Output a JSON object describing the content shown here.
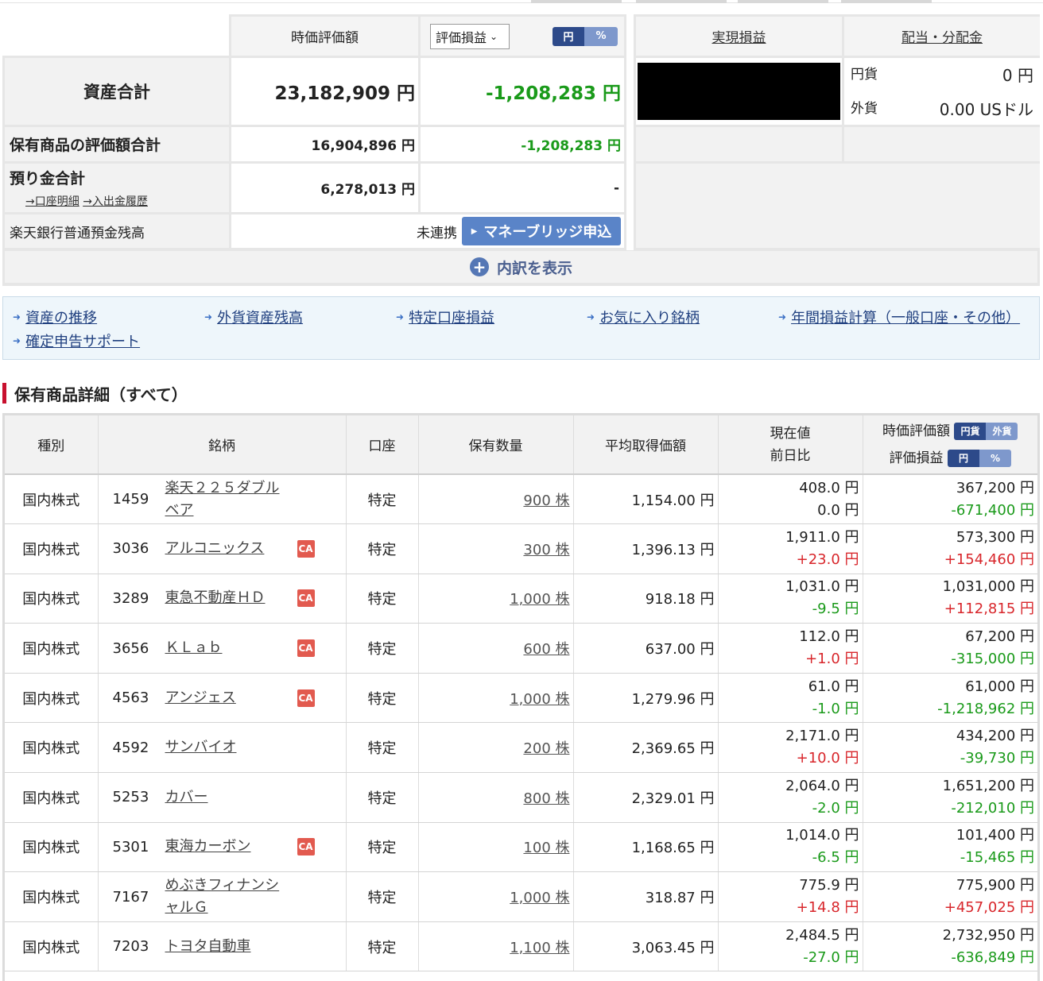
{
  "summary": {
    "col_market_value": "時価評価額",
    "col_pl_select": "評価損益",
    "unit_toggle": {
      "yen": "円",
      "pct": "%"
    },
    "realized_pl_link": "実現損益",
    "dividend_link": "配当・分配金",
    "total_assets_label": "資産合計",
    "total_assets_value": "23,182,909 円",
    "total_assets_pl": "-1,208,283 円",
    "holdings_label": "保有商品の評価額合計",
    "holdings_value": "16,904,896 円",
    "holdings_pl": "-1,208,283 円",
    "deposit_label": "預り金合計",
    "deposit_value": "6,278,013 円",
    "deposit_pl": "-",
    "account_detail_link": "→口座明細",
    "inout_history_link": "→入出金履歴",
    "bank_label": "楽天銀行普通預金残高",
    "bank_status": "未連携",
    "moneybridge_button": "マネーブリッジ申込",
    "show_breakdown": "内訳を表示",
    "dividend": {
      "jpy_label": "円貨",
      "jpy_value": "0 円",
      "fx_label": "外貨",
      "fx_value": "0.00 USドル"
    }
  },
  "quick_links": [
    "資産の推移",
    "外貨資産残高",
    "特定口座損益",
    "お気に入り銘柄",
    "年間損益計算（一般口座・その他）",
    "確定申告サポート"
  ],
  "holdings": {
    "title": "保有商品詳細（すべて）",
    "headers": {
      "type": "種別",
      "name": "銘柄",
      "account": "口座",
      "qty": "保有数量",
      "avg_cost": "平均取得価額",
      "price": "現在値",
      "change": "前日比",
      "market_value": "時価評価額",
      "pl": "評価損益",
      "ccy_toggle": {
        "a": "円貨",
        "b": "外貨"
      },
      "pl_toggle": {
        "a": "円",
        "b": "%"
      }
    },
    "rows": [
      {
        "type": "国内株式",
        "code": "1459",
        "name1": "楽天２２５ダブル",
        "name2": "ベア",
        "ca": "",
        "account": "特定",
        "qty": "900 株",
        "avg": "1,154.00 円",
        "price": "408.0 円",
        "change": "0.0 円",
        "change_dir": "flat",
        "value": "367,200 円",
        "pl": "-671,400 円",
        "pl_dir": "neg"
      },
      {
        "type": "国内株式",
        "code": "3036",
        "name1": "アルコニックス",
        "name2": "",
        "ca": "CA",
        "account": "特定",
        "qty": "300 株",
        "avg": "1,396.13 円",
        "price": "1,911.0 円",
        "change": "+23.0 円",
        "change_dir": "pos",
        "value": "573,300 円",
        "pl": "+154,460 円",
        "pl_dir": "pos"
      },
      {
        "type": "国内株式",
        "code": "3289",
        "name1": "東急不動産ＨＤ",
        "name2": "",
        "ca": "CA",
        "account": "特定",
        "qty": "1,000 株",
        "avg": "918.18 円",
        "price": "1,031.0 円",
        "change": "-9.5 円",
        "change_dir": "neg",
        "value": "1,031,000 円",
        "pl": "+112,815 円",
        "pl_dir": "pos"
      },
      {
        "type": "国内株式",
        "code": "3656",
        "name1": "ＫＬａｂ",
        "name2": "",
        "ca": "CA",
        "account": "特定",
        "qty": "600 株",
        "avg": "637.00 円",
        "price": "112.0 円",
        "change": "+1.0 円",
        "change_dir": "pos",
        "value": "67,200 円",
        "pl": "-315,000 円",
        "pl_dir": "neg"
      },
      {
        "type": "国内株式",
        "code": "4563",
        "name1": "アンジェス",
        "name2": "",
        "ca": "CA",
        "account": "特定",
        "qty": "1,000 株",
        "avg": "1,279.96 円",
        "price": "61.0 円",
        "change": "-1.0 円",
        "change_dir": "neg",
        "value": "61,000 円",
        "pl": "-1,218,962 円",
        "pl_dir": "neg"
      },
      {
        "type": "国内株式",
        "code": "4592",
        "name1": "サンバイオ",
        "name2": "",
        "ca": "",
        "account": "特定",
        "qty": "200 株",
        "avg": "2,369.65 円",
        "price": "2,171.0 円",
        "change": "+10.0 円",
        "change_dir": "pos",
        "value": "434,200 円",
        "pl": "-39,730 円",
        "pl_dir": "neg"
      },
      {
        "type": "国内株式",
        "code": "5253",
        "name1": "カバー",
        "name2": "",
        "ca": "",
        "account": "特定",
        "qty": "800 株",
        "avg": "2,329.01 円",
        "price": "2,064.0 円",
        "change": "-2.0 円",
        "change_dir": "neg",
        "value": "1,651,200 円",
        "pl": "-212,010 円",
        "pl_dir": "neg"
      },
      {
        "type": "国内株式",
        "code": "5301",
        "name1": "東海カーボン",
        "name2": "",
        "ca": "CA",
        "account": "特定",
        "qty": "100 株",
        "avg": "1,168.65 円",
        "price": "1,014.0 円",
        "change": "-6.5 円",
        "change_dir": "neg",
        "value": "101,400 円",
        "pl": "-15,465 円",
        "pl_dir": "neg"
      },
      {
        "type": "国内株式",
        "code": "7167",
        "name1": "めぶきフィナンシ",
        "name2": "ャルＧ",
        "ca": "",
        "account": "特定",
        "qty": "1,000 株",
        "avg": "318.87 円",
        "price": "775.9 円",
        "change": "+14.8 円",
        "change_dir": "pos",
        "value": "775,900 円",
        "pl": "+457,025 円",
        "pl_dir": "pos"
      },
      {
        "type": "国内株式",
        "code": "7203",
        "name1": "トヨタ自動車",
        "name2": "",
        "ca": "",
        "account": "特定",
        "qty": "1,100 株",
        "avg": "3,063.45 円",
        "price": "2,484.5 円",
        "change": "-27.0 円",
        "change_dir": "neg",
        "value": "2,732,950 円",
        "pl": "-636,849 円",
        "pl_dir": "neg"
      }
    ]
  },
  "colors": {
    "positive": "#d8262b",
    "negative": "#1a9a1a",
    "accent": "#2d4a8a",
    "section_marker": "#c8102e"
  }
}
